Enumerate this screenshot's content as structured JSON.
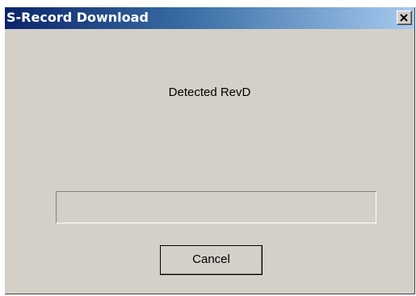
{
  "window": {
    "title": "S-Record Download",
    "close_icon": "close-icon"
  },
  "body": {
    "status_text": "Detected RevD"
  },
  "progress": {
    "value_percent": 0
  },
  "buttons": {
    "cancel_label": "Cancel"
  },
  "colors": {
    "title_gradient_start": "#0a246a",
    "title_gradient_end": "#a6caf0",
    "dialog_background": "#d4d0c8"
  }
}
